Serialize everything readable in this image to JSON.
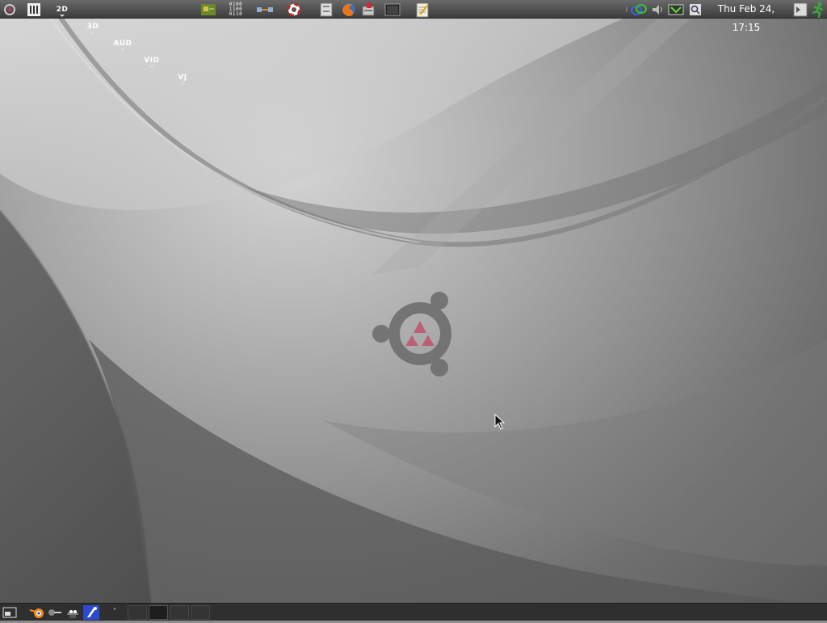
{
  "top_panel": {
    "menus": [
      {
        "id": "menu-2d",
        "label": "2D"
      },
      {
        "id": "menu-3d",
        "label": "3D"
      },
      {
        "id": "menu-audio",
        "label": "AUD"
      },
      {
        "id": "menu-video",
        "label": "VID"
      },
      {
        "id": "menu-vj",
        "label": "VJ"
      }
    ],
    "binary_label": [
      "0100",
      "1100",
      "0110"
    ],
    "clock": "Thu Feb 24, 17:15",
    "icons": [
      "ubuntu-studio-logo-icon",
      "mixer-icon",
      "circuit-board-icon",
      "binary-icon",
      "network-icon",
      "lifebuoy-icon",
      "file-manager-icon",
      "firefox-icon",
      "package-icon",
      "terminal-icon",
      "text-editor-icon",
      "network-tray-icon",
      "volume-icon",
      "battery-icon",
      "search-icon",
      "window-switch-icon",
      "run-icon"
    ]
  },
  "bottom_panel": {
    "launchers": [
      "show-desktop-icon",
      "blender-icon",
      "audio-tool-icon",
      "gimp-icon",
      "inkscape-icon"
    ],
    "up_arrow": "˄",
    "workspaces": [
      1,
      2,
      3,
      4
    ],
    "active_workspace": 2
  },
  "colors": {
    "panel_top": "#6a6a6a",
    "panel_bottom": "#3c3c3c",
    "bottom_panel": "#2f2f2f",
    "logo_accent": "#c43b5c"
  }
}
